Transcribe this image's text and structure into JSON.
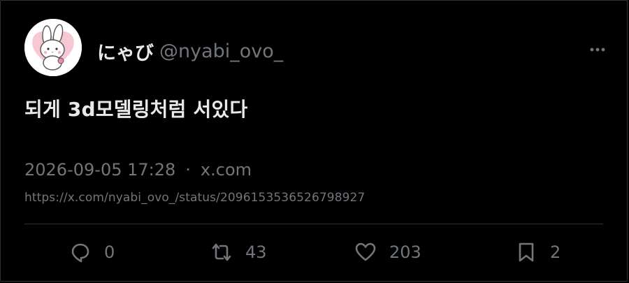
{
  "author": {
    "display_name": "にゃび",
    "handle": "@nyabi_ovo_",
    "avatar_icon": "bunny-avatar-icon"
  },
  "tweet": {
    "text": "되게 3d모델링처럼 서있다"
  },
  "meta": {
    "timestamp": "2026-09-05 17:28",
    "separator": "·",
    "source": "x.com",
    "url": "https://x.com/nyabi_ovo_/status/2096153536526798927"
  },
  "actions": {
    "reply": {
      "icon": "reply-icon",
      "count": "0"
    },
    "retweet": {
      "icon": "retweet-icon",
      "count": "43"
    },
    "like": {
      "icon": "heart-icon",
      "count": "203"
    },
    "bookmark": {
      "icon": "bookmark-icon",
      "count": "2"
    }
  },
  "colors": {
    "background": "#000000",
    "primary_text": "#e7e9ea",
    "secondary_text": "#71767b",
    "border": "#2f3336",
    "avatar_accent": "#f7c8d4"
  }
}
